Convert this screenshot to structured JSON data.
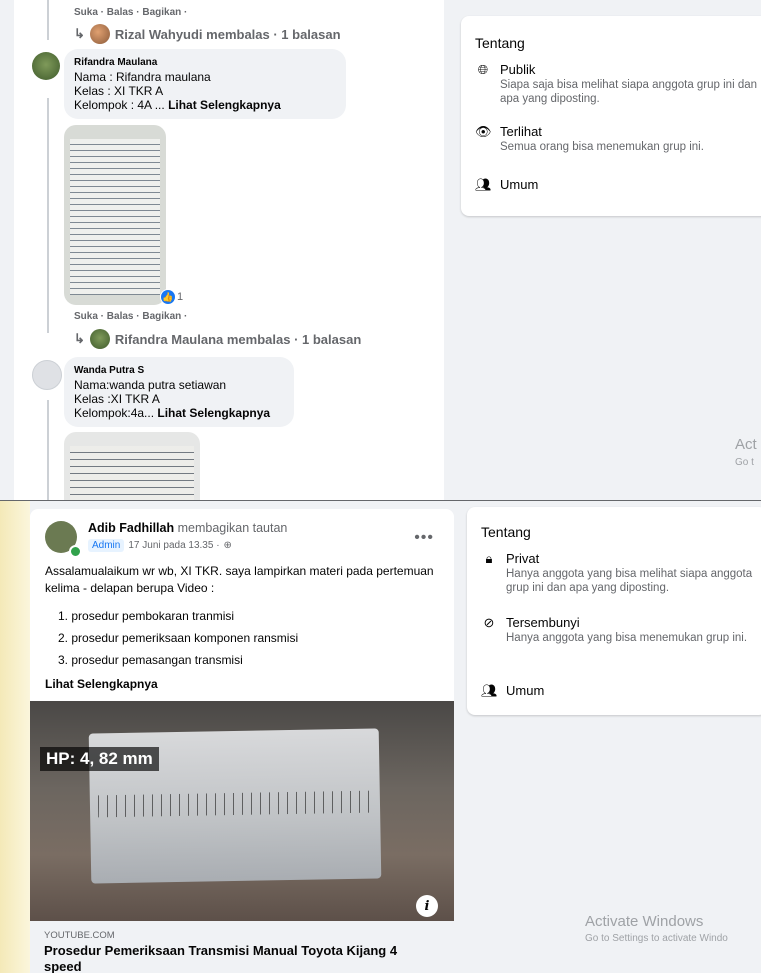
{
  "colors": {
    "page_bg": "#f0f2f5",
    "accent": "#1877f2",
    "online": "#31a24c"
  },
  "top": {
    "comment_actions_1": "Suka · Balas · Bagikan ·",
    "reply_1": "Rizal Wahyudi membalas · 1 balasan",
    "comment_1": {
      "name": "Rifandra Maulana",
      "line1": "Nama : Rifandra maulana",
      "line2": "Kelas : XI TKR A",
      "line3": "Kelompok : 4A ...",
      "see_more": "Lihat Selengkapnya",
      "reactions": "1"
    },
    "comment_actions_2": "Suka · Balas · Bagikan ·",
    "reply_2": "Rifandra Maulana membalas · 1 balasan",
    "comment_2": {
      "name": "Wanda Putra S",
      "line1": "Nama:wanda putra setiawan",
      "line2": "Kelas :XI TKR A",
      "line3": "Kelompok:4a...",
      "see_more": "Lihat Selengkapnya"
    },
    "about": {
      "title": "Tentang",
      "items": [
        {
          "icon": "globe-icon",
          "title": "Publik",
          "desc": "Siapa saja bisa melihat siapa anggota grup ini dan apa yang diposting."
        },
        {
          "icon": "eye-icon",
          "title": "Terlihat",
          "desc": "Semua orang bisa menemukan grup ini."
        },
        {
          "icon": "people-icon",
          "title": "Umum",
          "desc": ""
        }
      ]
    },
    "watermark_1": "Act",
    "watermark_2": "Go t"
  },
  "bottom": {
    "post": {
      "author": "Adib Fadhillah",
      "action": "membagikan tautan",
      "badge": "Admin",
      "date": "17 Juni pada 13.35 ·",
      "body": "Assalamualaikum wr wb, XI TKR. saya lampirkan materi pada pertemuan kelima - delapan berupa Video :",
      "list": [
        "prosedur pembokaran tranmisi",
        "prosedur pemeriksaan komponen ransmisi",
        "prosedur pemasangan transmisi"
      ],
      "see_more": "Lihat Selengkapnya",
      "video_overlay": "HP: 4, 82 mm",
      "link_domain": "YOUTUBE.COM",
      "link_title": "Prosedur Pemeriksaan Transmisi Manual Toyota Kijang 4 speed"
    },
    "about": {
      "title": "Tentang",
      "items": [
        {
          "icon": "lock-icon",
          "title": "Privat",
          "desc": "Hanya anggota yang bisa melihat siapa anggota grup ini dan apa yang diposting."
        },
        {
          "icon": "eye-slash-icon",
          "title": "Tersembunyi",
          "desc": "Hanya anggota yang bisa menemukan grup ini."
        },
        {
          "icon": "people-icon",
          "title": "Umum",
          "desc": ""
        }
      ]
    },
    "watermark_title": "Activate Windows",
    "watermark_sub": "Go to Settings to activate Windo"
  }
}
